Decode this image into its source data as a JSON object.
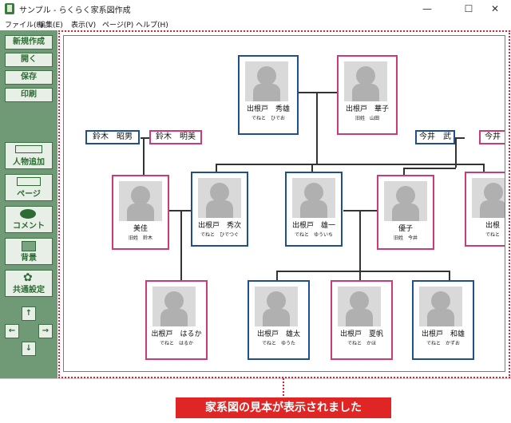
{
  "window": {
    "title": "サンプル - らくらく家系図作成",
    "controls": [
      "—",
      "☐",
      "✕"
    ]
  },
  "menu": [
    "ファイル(F)",
    "編集(E)",
    "表示(V)",
    "ページ(P)",
    "ヘルプ(H)"
  ],
  "sidebar": {
    "buttons": [
      "新規作成",
      "開く",
      "保存",
      "印刷"
    ],
    "icon_buttons": [
      "人物追加",
      "ページ",
      "コメント",
      "背景",
      "共通設定"
    ]
  },
  "family": {
    "gen1": [
      {
        "name": "出根戸　秀雄",
        "sub": "でねと　ひでお",
        "gender": "male"
      },
      {
        "name": "出根戸　華子",
        "sub": "旧姓　山田",
        "gender": "female"
      }
    ],
    "left_inlaws": [
      "鈴木　昭男",
      "鈴木　明美"
    ],
    "right_inlaws": [
      "今井　武",
      "今井"
    ],
    "gen2": [
      {
        "name": "美佳",
        "sub": "旧姓　鈴木",
        "gender": "female"
      },
      {
        "name": "出根戸　秀次",
        "sub": "でねと　ひでつぐ",
        "gender": "male"
      },
      {
        "name": "出根戸　雄一",
        "sub": "でねと　ゆういち",
        "gender": "male"
      },
      {
        "name": "優子",
        "sub": "旧姓　今井",
        "gender": "female"
      },
      {
        "name": "出根",
        "sub": "でねと",
        "gender": "female"
      }
    ],
    "gen3": [
      {
        "name": "出根戸　はるか",
        "sub": "でねと　はるか",
        "gender": "female"
      },
      {
        "name": "出根戸　雄太",
        "sub": "でねと　ゆうた",
        "gender": "male"
      },
      {
        "name": "出根戸　夏帆",
        "sub": "でねと　かほ",
        "gender": "female"
      },
      {
        "name": "出根戸　和雄",
        "sub": "でねと　かずお",
        "gender": "male"
      }
    ]
  },
  "status_message": "家系図の見本が表示されました"
}
